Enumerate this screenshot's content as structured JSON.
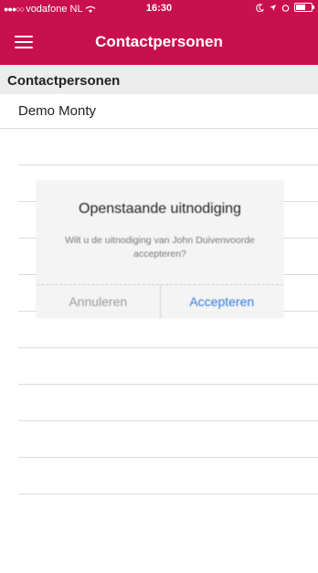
{
  "statusbar": {
    "carrier": "vodafone NL",
    "time": "16:30",
    "battery_level": 0.7
  },
  "navbar": {
    "title": "Contactpersonen",
    "menu_icon": "hamburger-icon"
  },
  "section": {
    "header": "Contactpersonen"
  },
  "contacts": [
    "Demo Monty"
  ],
  "dialog": {
    "title": "Openstaande uitnodiging",
    "message": "Wilt u de uitnodiging van John Duivenvoorde accepteren?",
    "cancel_label": "Annuleren",
    "accept_label": "Accepteren"
  }
}
